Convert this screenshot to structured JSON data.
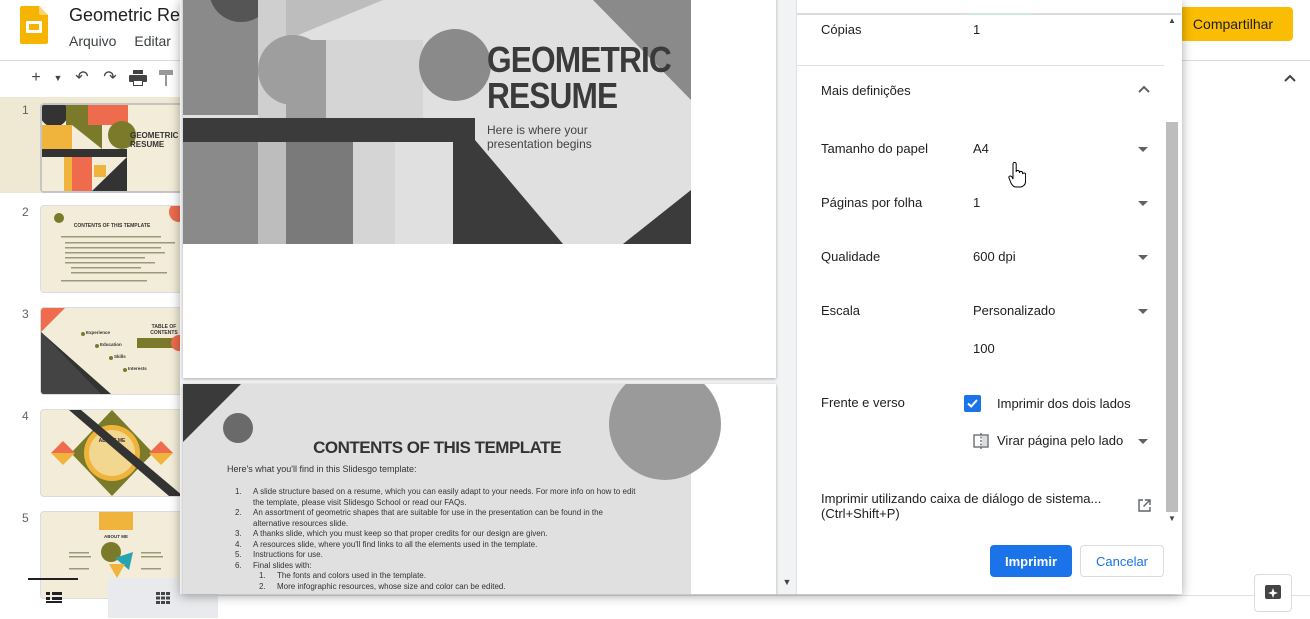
{
  "app": {
    "doc_title": "Geometric Re",
    "menu": [
      "Arquivo",
      "Editar"
    ],
    "share_label": "Compartilhar"
  },
  "filmstrip": {
    "slides": [
      {
        "number": "1",
        "title": "GEOMETRIC RESUME"
      },
      {
        "number": "2",
        "title": "CONTENTS OF THIS TEMPLATE"
      },
      {
        "number": "3",
        "title": "TABLE OF CONTENTS",
        "items": [
          "Experience",
          "Education",
          "Skills",
          "Interests"
        ]
      },
      {
        "number": "4",
        "title": "ABOUT ME"
      },
      {
        "number": "5",
        "title": "ABOUT ME"
      }
    ]
  },
  "preview": {
    "page1": {
      "title_line1": "GEOMETRIC",
      "title_line2": "RESUME",
      "subtitle_line1": "Here is where your",
      "subtitle_line2": "presentation begins"
    },
    "page2": {
      "title": "CONTENTS OF THIS TEMPLATE",
      "intro": "Here's what you'll find in this Slidesgo template:",
      "items": [
        {
          "num": "1.",
          "line1": "A slide structure based on a resume, which you can easily adapt to your needs. For more info on how to edit",
          "line2": "the template, please visit Slidesgo School or read our FAQs."
        },
        {
          "num": "2.",
          "line1": "An assortment of geometric shapes that are suitable for use in the presentation can be found in the",
          "line2": "alternative resources slide."
        },
        {
          "num": "3.",
          "line1": "A thanks slide, which you must keep so that proper credits for our design are given.",
          "line2": ""
        },
        {
          "num": "4.",
          "line1": "A resources slide, where you'll find links to all the elements used in the template.",
          "line2": ""
        },
        {
          "num": "5.",
          "line1": "Instructions for use.",
          "line2": ""
        },
        {
          "num": "6.",
          "line1": "Final slides with:",
          "line2": ""
        }
      ],
      "subitems": [
        {
          "num": "1.",
          "text": "The fonts and colors used in the template."
        },
        {
          "num": "2.",
          "text": "More infographic resources, whose size and color can be edited."
        }
      ]
    }
  },
  "settings": {
    "copies_label": "Cópias",
    "copies_value": "1",
    "more_settings_label": "Mais definições",
    "paper_size_label": "Tamanho do papel",
    "paper_size_value": "A4",
    "pages_per_sheet_label": "Páginas por folha",
    "pages_per_sheet_value": "1",
    "quality_label": "Qualidade",
    "quality_value": "600 dpi",
    "scale_label": "Escala",
    "scale_value": "Personalizado",
    "scale_custom_value": "100",
    "duplex_label": "Frente e verso",
    "duplex_checkbox_label": "Imprimir dos dois lados",
    "duplex_checked": true,
    "flip_label": "Virar página pelo lado",
    "system_dialog_line1": "Imprimir utilizando caixa de diálogo de sistema...",
    "system_dialog_line2": "(Ctrl+Shift+P)",
    "print_label": "Imprimir",
    "cancel_label": "Cancelar"
  },
  "colors": {
    "accent": "#1a73e8",
    "share": "#fbbc04",
    "slide_olive": "#7a7a2a",
    "slide_coral": "#ee6c4d",
    "slide_yellow": "#f0b43c",
    "slide_cream": "#f2ecd8",
    "slide_dark": "#333333"
  }
}
